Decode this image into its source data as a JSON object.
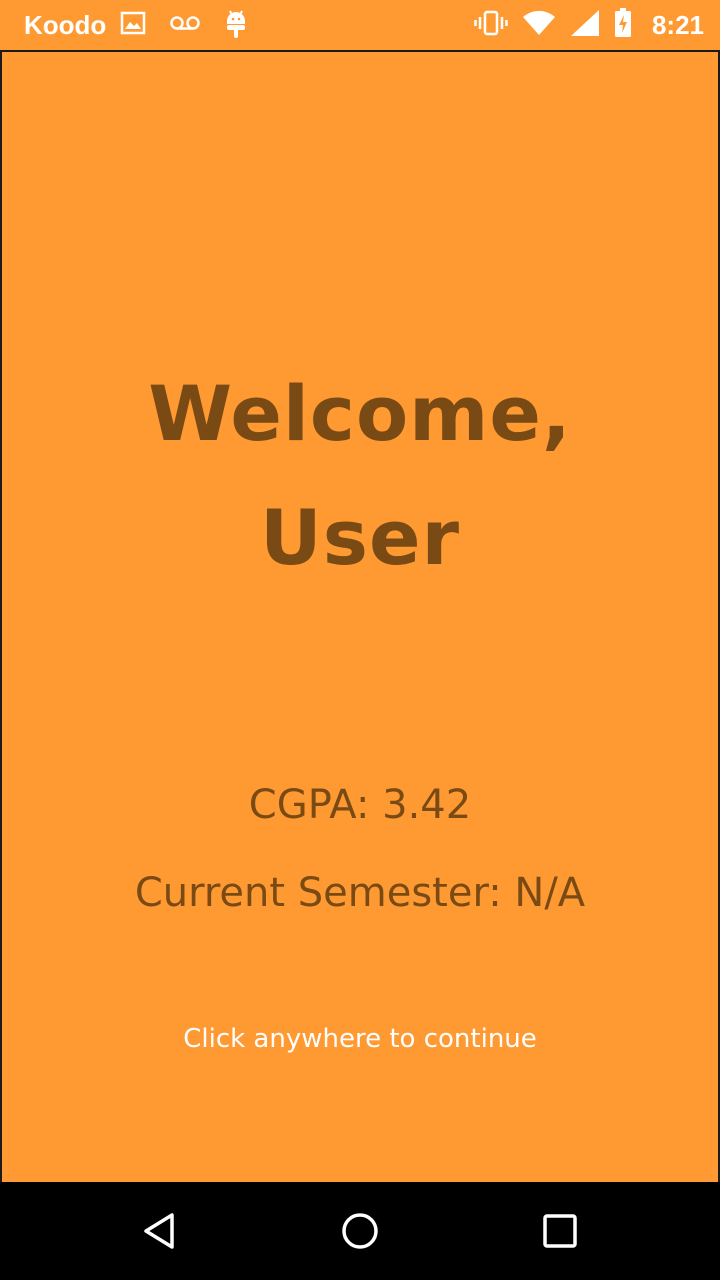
{
  "status_bar": {
    "carrier": "Koodo",
    "time": "8:21",
    "icons_left": [
      "image-icon",
      "voicemail-icon",
      "android-icon"
    ],
    "icons_right": [
      "vibrate-icon",
      "wifi-icon",
      "signal-icon",
      "battery-charging-icon"
    ]
  },
  "screen": {
    "welcome_line1": "Welcome,",
    "welcome_line2": "User",
    "cgpa_text": "CGPA: 3.42",
    "semester_text": "Current Semester: N/A",
    "hint_text": "Click anywhere to continue"
  },
  "nav_bar": {
    "buttons": [
      "back-icon",
      "home-icon",
      "recents-icon"
    ]
  },
  "colors": {
    "background": "#FF9A33",
    "title_text": "#7A4A14",
    "hint_text": "#FFFFFF",
    "nav_bar": "#000000"
  }
}
